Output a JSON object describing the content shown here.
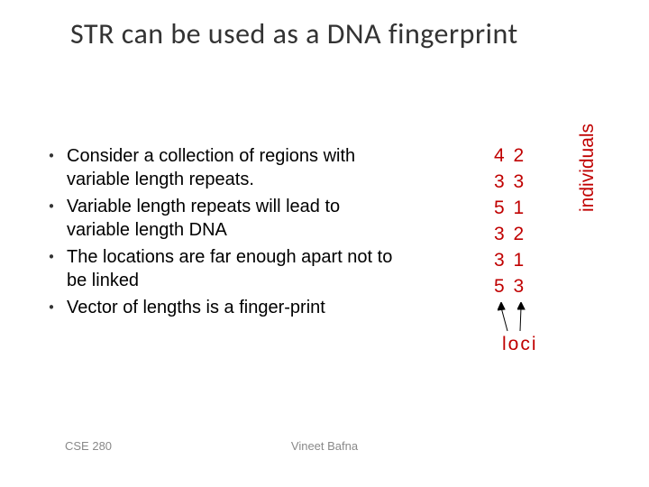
{
  "title": "STR can be used as a DNA fingerprint",
  "bullets": [
    "Consider a collection of regions with variable length repeats.",
    "Variable length repeats will lead to variable length DNA",
    "The locations are far enough apart not to be linked",
    "Vector of lengths is a finger-print"
  ],
  "chart_data": {
    "type": "table",
    "title": "",
    "xlabel": "loci",
    "ylabel": "individuals",
    "rows": [
      [
        4,
        2
      ],
      [
        3,
        3
      ],
      [
        5,
        1
      ],
      [
        3,
        2
      ],
      [
        3,
        1
      ],
      [
        5,
        3
      ]
    ]
  },
  "footer": {
    "left": "CSE 280",
    "center": "Vineet Bafna"
  }
}
